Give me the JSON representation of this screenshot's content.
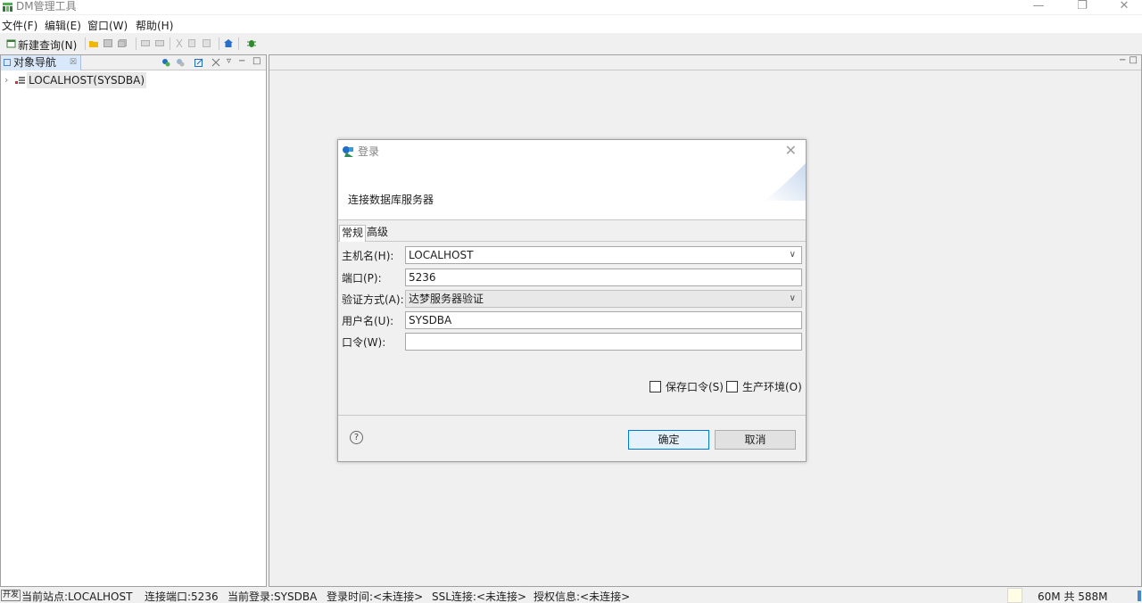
{
  "window": {
    "title": "DM管理工具",
    "minimize": "—",
    "restore": "❐",
    "close": "✕"
  },
  "menu": [
    "文件(F)",
    "编辑(E)",
    "窗口(W)",
    "帮助(H)"
  ],
  "toolbar": {
    "new_query": "新建查询(N)"
  },
  "navigator": {
    "tab_label": "对象导航",
    "tab_close": "☒",
    "tools": [
      "▿",
      "−",
      "□"
    ],
    "tree": [
      {
        "chevron": "›",
        "label": "LOCALHOST(SYSDBA)"
      }
    ]
  },
  "editor": {
    "tools": "− □"
  },
  "dialog": {
    "title": "登录",
    "close": "✕",
    "subtitle": "连接数据库服务器",
    "tabs": [
      "常规",
      "高级"
    ],
    "fields": {
      "host_label": "主机名(H):",
      "host_value": "LOCALHOST",
      "port_label": "端口(P):",
      "port_value": "5236",
      "auth_label": "验证方式(A):",
      "auth_value": "达梦服务器验证",
      "user_label": "用户名(U):",
      "user_value": "SYSDBA",
      "password_label": "口令(W):",
      "password_value": ""
    },
    "checkboxes": {
      "save_password": "保存口令(S)",
      "production_env": "生产环境(O)"
    },
    "help": "?",
    "ok_button": "确定",
    "cancel_button": "取消"
  },
  "statusbar": {
    "mode": "开发",
    "site": "当前站点:LOCALHOST",
    "port": "连接端口:5236",
    "login": "当前登录:SYSDBA",
    "login_time": "登录时间:<未连接>",
    "ssl": "SSL连接:<未连接>",
    "license": "授权信息:<未连接>",
    "memory": "60M 共 588M"
  },
  "colors": {
    "accent": "#0078d7",
    "tab_selected": "#d9e8fa",
    "background": "#f0f0f0"
  },
  "icons": [
    "app-icon",
    "new-query-icon",
    "open-folder-icon",
    "save-icon",
    "save-all-icon",
    "undo-icon",
    "redo-icon",
    "cut-icon",
    "copy-icon",
    "paste-icon",
    "home-icon",
    "debug-icon",
    "database-icon",
    "login-icon",
    "help-icon",
    "checkbox-icon"
  ]
}
